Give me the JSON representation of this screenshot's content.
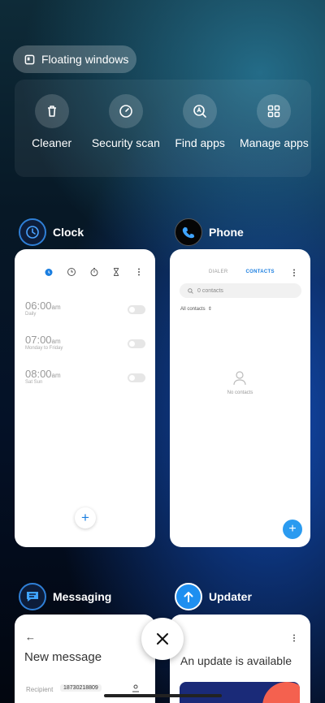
{
  "floating": {
    "label": "Floating windows",
    "icon": "floating-window-icon"
  },
  "tools": [
    {
      "label": "Cleaner",
      "icon": "trash-icon"
    },
    {
      "label": "Security scan",
      "icon": "shield-gauge-icon"
    },
    {
      "label": "Find apps",
      "icon": "search-apps-icon"
    },
    {
      "label": "Manage apps",
      "icon": "grid-icon"
    }
  ],
  "apps": {
    "clock": {
      "name": "Clock",
      "alarms": [
        {
          "time": "06:00",
          "ampm": "am",
          "repeat": "Daily"
        },
        {
          "time": "07:00",
          "ampm": "am",
          "repeat": "Monday to Friday"
        },
        {
          "time": "08:00",
          "ampm": "am",
          "repeat": "Sat Sun"
        }
      ],
      "add": "+"
    },
    "phone": {
      "name": "Phone",
      "tab_dialer": "DIALER",
      "tab_contacts": "CONTACTS",
      "search_placeholder": "0 contacts",
      "filter": "All contacts",
      "empty": "No contacts",
      "add": "+"
    },
    "messaging": {
      "name": "Messaging",
      "back": "←",
      "title": "New message",
      "recipient_label": "Recipient",
      "recipient_value": "18730218809"
    },
    "updater": {
      "name": "Updater",
      "headline": "An update is available"
    }
  },
  "colors": {
    "accent": "#1a7ee0",
    "fab_blue": "#2b9bf0"
  }
}
